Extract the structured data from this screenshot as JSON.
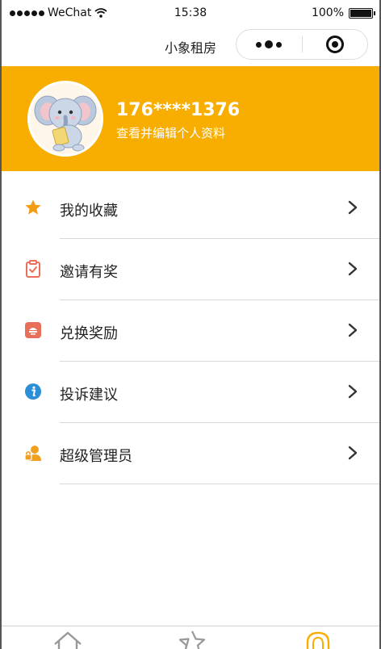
{
  "status_bar": {
    "carrier": "WeChat",
    "time": "15:38",
    "battery": "100%"
  },
  "nav": {
    "title": "小象租房"
  },
  "profile": {
    "phone": "176****1376",
    "edit_text": "查看并编辑个人资料"
  },
  "menu": [
    {
      "label": "我的收藏",
      "icon": "star-icon",
      "color": "#f39c12"
    },
    {
      "label": "邀请有奖",
      "icon": "clipboard-icon",
      "color": "#e8705a"
    },
    {
      "label": "兑换奖励",
      "icon": "gift-icon",
      "color": "#e8705a"
    },
    {
      "label": "投诉建议",
      "icon": "info-icon",
      "color": "#2a8fd6"
    },
    {
      "label": "超级管理员",
      "icon": "admin-icon",
      "color": "#f0a020"
    }
  ],
  "tabbar": {
    "tabs": [
      {
        "icon": "home-icon",
        "active": false
      },
      {
        "icon": "star-outline-icon",
        "active": false
      },
      {
        "icon": "user-icon",
        "active": true
      }
    ],
    "active_color": "#f8ae00",
    "inactive_color": "#999999"
  },
  "colors": {
    "brand": "#f8ae00"
  }
}
